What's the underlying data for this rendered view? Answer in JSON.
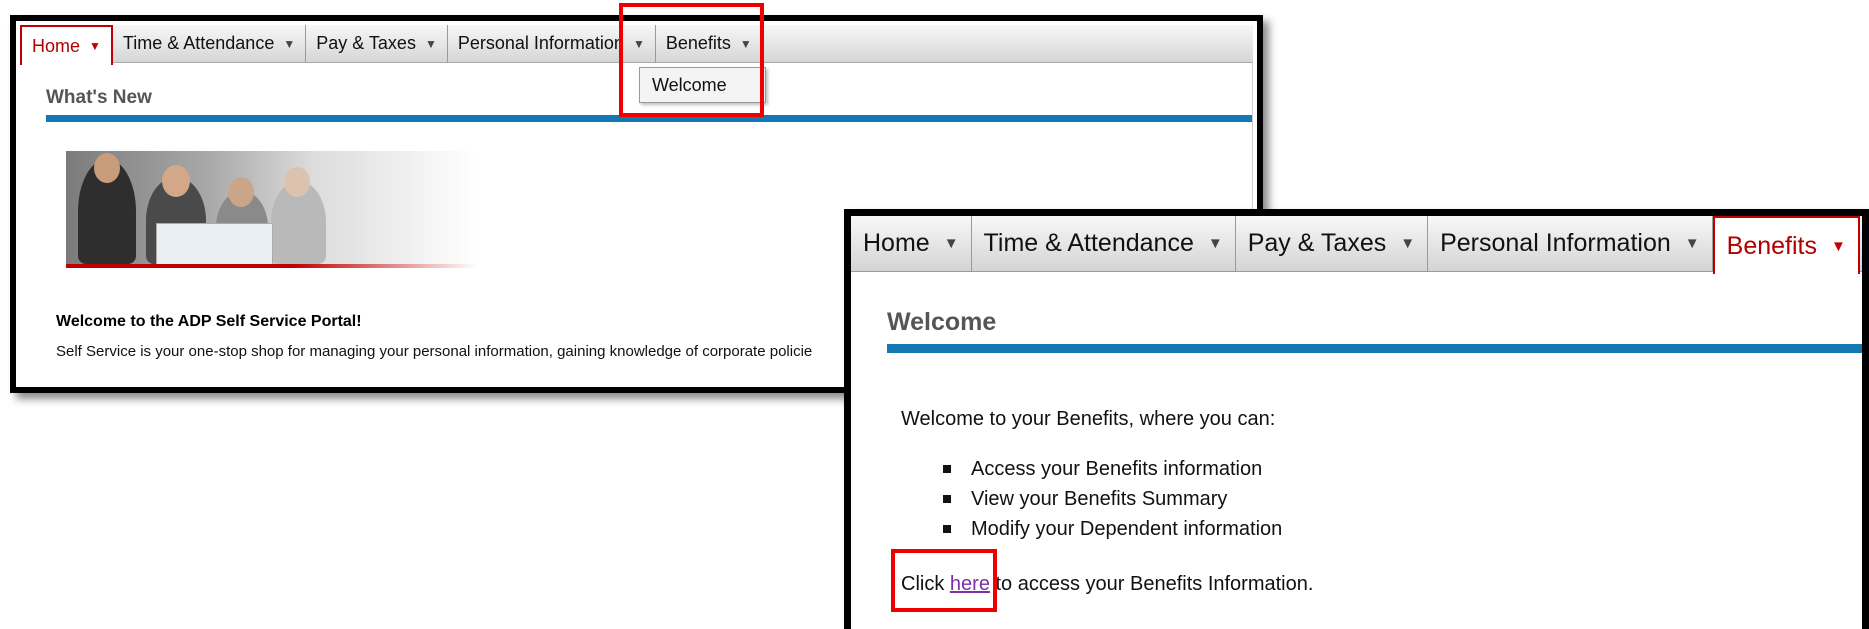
{
  "window1": {
    "nav_tabs": [
      {
        "label": "Home"
      },
      {
        "label": "Time & Attendance"
      },
      {
        "label": "Pay & Taxes"
      },
      {
        "label": "Personal Information"
      },
      {
        "label": "Benefits"
      }
    ],
    "active_tab": "Home",
    "dropdown_item": "Welcome",
    "section_title": "What's New",
    "welcome_heading": "Welcome to the ADP Self Service Portal!",
    "welcome_text": "Self Service is your one-stop shop for managing your personal information, gaining knowledge of corporate policie"
  },
  "window2": {
    "nav_tabs": [
      {
        "label": "Home"
      },
      {
        "label": "Time & Attendance"
      },
      {
        "label": "Pay & Taxes"
      },
      {
        "label": "Personal Information"
      },
      {
        "label": "Benefits"
      }
    ],
    "active_tab": "Benefits",
    "section_title": "Welcome",
    "intro": "Welcome to your Benefits, where you can:",
    "bullets": [
      "Access your Benefits information",
      "View your Benefits Summary",
      "Modify your Dependent information"
    ],
    "click_prefix": "Click",
    "link_text": "here",
    "click_suffix": "to access your Benefits Information."
  },
  "colors": {
    "active_tab": "#c00000",
    "section_bar": "#1479b3",
    "highlight_box": "#ee0000",
    "link": "#7b2fa8"
  },
  "icons": [
    "dropdown-caret-icon",
    "bullet-square-icon"
  ]
}
